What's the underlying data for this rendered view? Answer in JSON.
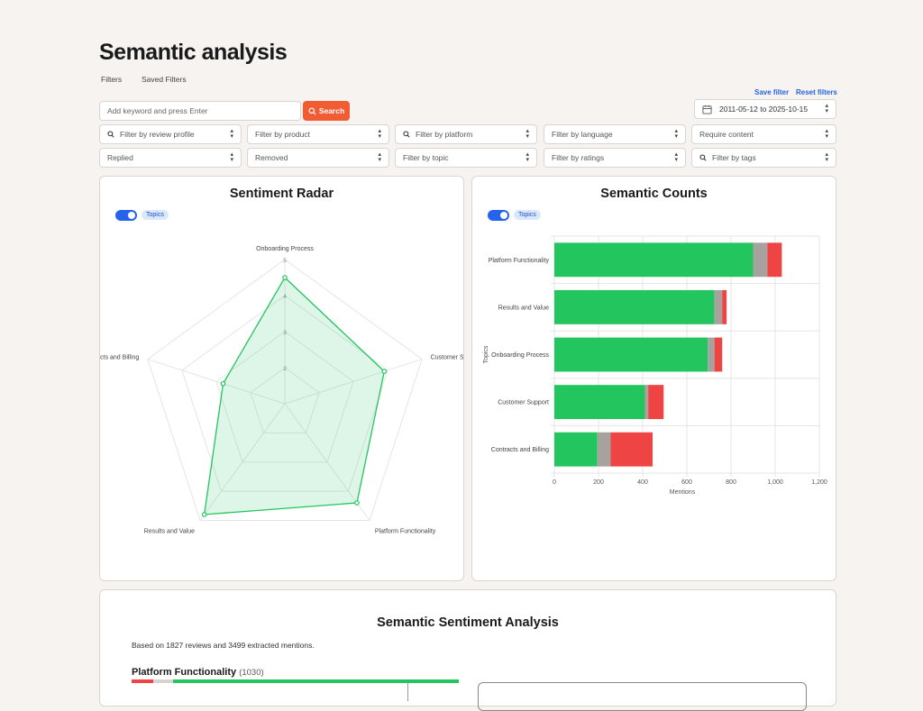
{
  "page": {
    "title": "Semantic analysis",
    "tabs": [
      "Filters",
      "Saved Filters"
    ],
    "save_filter": "Save filter",
    "reset_filters": "Reset filters"
  },
  "search": {
    "placeholder": "Add keyword and press Enter",
    "button_label": "Search"
  },
  "date_range": "2011-05-12 to 2025-10-15",
  "filters": {
    "review_profile": "Filter by review profile",
    "product": "Filter by product",
    "platform": "Filter by platform",
    "language": "Filter by language",
    "require_content": "Require content",
    "replied": "Replied",
    "removed": "Removed",
    "topic": "Filter by topic",
    "ratings": "Filter by ratings",
    "tags": "Filter by tags"
  },
  "radar": {
    "title": "Sentiment Radar",
    "toggle_label": "Topics"
  },
  "counts": {
    "title": "Semantic Counts",
    "toggle_label": "Topics"
  },
  "analysis": {
    "title": "Semantic Sentiment Analysis",
    "summary": "Based on 1827 reviews and 3499 extracted mentions.",
    "first_topic": {
      "name": "Platform Functionality",
      "count": "(1030)"
    }
  },
  "chart_data": [
    {
      "type": "radar",
      "title": "Sentiment Radar",
      "axes": [
        "Onboarding Process",
        "Customer Support",
        "Platform Functionality",
        "Results and Value",
        "Contracts and Billing"
      ],
      "rmin": 1,
      "rmax": 5,
      "ticks": [
        "2",
        "3",
        "4",
        "5"
      ],
      "values": [
        4.5,
        3.9,
        4.4,
        4.8,
        2.8
      ],
      "color": "#22c55e"
    },
    {
      "type": "bar",
      "orientation": "horizontal",
      "stacked": true,
      "title": "Semantic Counts",
      "xlabel": "Mentions",
      "ylabel": "Topics",
      "categories": [
        "Platform Functionality",
        "Results and Value",
        "Onboarding Process",
        "Customer Support",
        "Contracts and Billing"
      ],
      "xlim": [
        0,
        1200
      ],
      "xticks": [
        0,
        200,
        400,
        600,
        800,
        1000,
        1200
      ],
      "xtick_labels": [
        "0",
        "200",
        "400",
        "600",
        "800",
        "1,000",
        "1,200"
      ],
      "series": [
        {
          "values": [
            900,
            725,
            695,
            410,
            195
          ],
          "color": "#22c55e"
        },
        {
          "values": [
            65,
            35,
            30,
            15,
            60
          ],
          "color": "#a8a29e"
        },
        {
          "values": [
            65,
            20,
            35,
            70,
            190
          ],
          "color": "#ef4444"
        }
      ]
    }
  ]
}
